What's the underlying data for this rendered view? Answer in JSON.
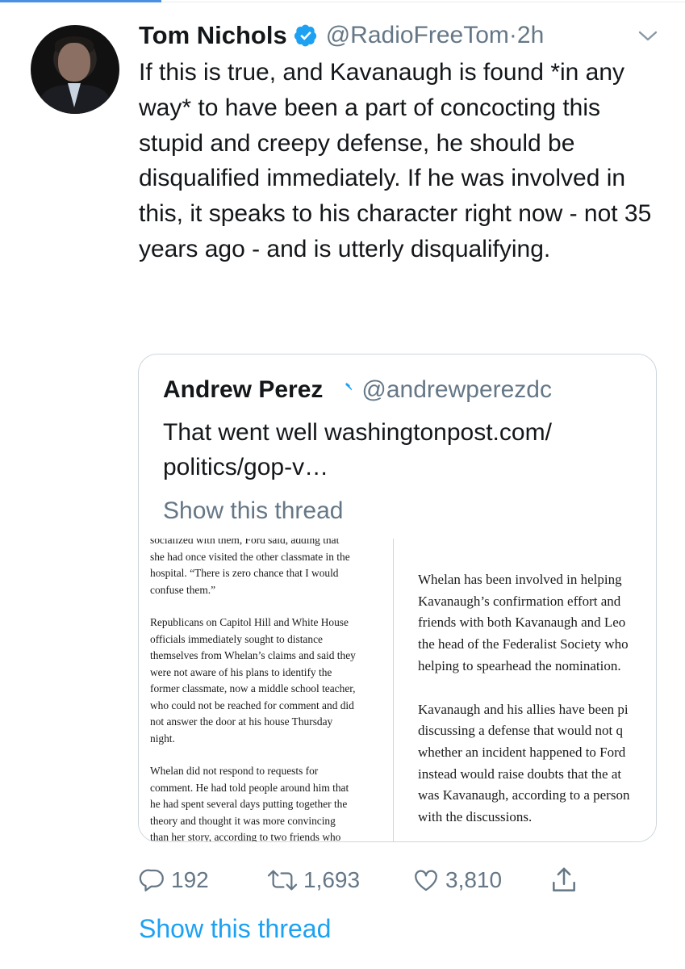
{
  "tweet": {
    "author_name": "Tom Nichols",
    "author_handle": "@RadioFreeTom",
    "separator": "·",
    "time": "2h",
    "text": "If this is true, and Kavanaugh is found *in any way* to have been a part of concocting this stupid and creepy defense, he should be disqualified immediately. If he was involved in this, it speaks to his character right now - not 35 years ago - and is utterly disqualifying."
  },
  "quote": {
    "author_name": "Andrew Perez",
    "author_handle": "@andrewperezdc",
    "text": "That went well washingtonpost.com/ politics/gop-v…",
    "show_thread": "Show this thread",
    "article": {
      "left_lines": [
        [
          "socialized with them, Ford said, adding that",
          "she had once visited the other classmate in the",
          "hospital. “There is zero chance that I would",
          "confuse them.”"
        ],
        [
          "Republicans on Capitol Hill and White House",
          "officials immediately sought to distance",
          "themselves from Whelan’s claims and said they",
          "were not aware of his plans to identify the",
          "former classmate, now a middle school teacher,",
          "who could not be reached for comment and did",
          "not answer the door at his house Thursday",
          "night."
        ],
        [
          "Whelan did not respond to requests for",
          "comment. He had told people around him that",
          "he had spent several days putting together the",
          "theory and thought it was more convincing",
          "than her story, according to two friends who"
        ]
      ],
      "right_lines": [
        [
          "Whelan has been involved in helping",
          "Kavanaugh’s confirmation effort and",
          "friends with both Kavanaugh and Leo",
          "the head of the Federalist Society who",
          "helping to spearhead the nomination."
        ],
        [
          "Kavanaugh and his allies have been pi",
          "discussing a defense that would not q",
          "whether an incident happened to Ford",
          "instead would raise doubts that the at",
          "was Kavanaugh, according to a person",
          "with the discussions."
        ]
      ]
    }
  },
  "actions": {
    "replies": "192",
    "retweets": "1,693",
    "likes": "3,810"
  },
  "show_thread": "Show this thread",
  "icons": {
    "verified": "verified-badge-icon",
    "chevron": "chevron-down-icon",
    "reply": "reply-icon",
    "retweet": "retweet-icon",
    "like": "heart-icon",
    "share": "share-icon"
  },
  "colors": {
    "link": "#1da1f2",
    "muted": "#657786",
    "verified": "#1da1f2"
  }
}
